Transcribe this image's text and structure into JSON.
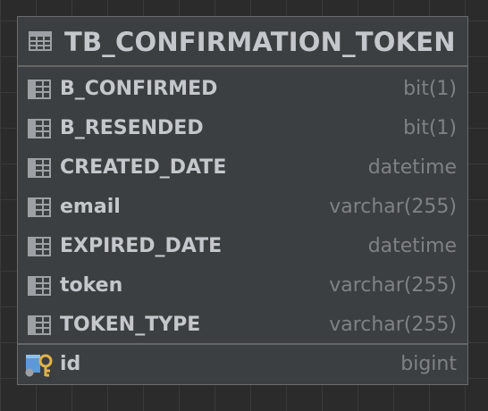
{
  "table": {
    "name": "TB_CONFIRMATION_TOKEN",
    "columns": [
      {
        "name": "B_CONFIRMED",
        "type": "bit(1)"
      },
      {
        "name": "B_RESENDED",
        "type": "bit(1)"
      },
      {
        "name": "CREATED_DATE",
        "type": "datetime"
      },
      {
        "name": "email",
        "type": "varchar(255)"
      },
      {
        "name": "EXPIRED_DATE",
        "type": "datetime"
      },
      {
        "name": "token",
        "type": "varchar(255)"
      },
      {
        "name": "TOKEN_TYPE",
        "type": "varchar(255)"
      }
    ],
    "primary_key": {
      "name": "id",
      "type": "bigint"
    }
  },
  "icons": {
    "table": "table-icon",
    "column": "column-icon",
    "primary_key": "primary-key-icon"
  },
  "colors": {
    "background": "#2b2b2b",
    "grid": "#3a3a3a",
    "entity_fill": "#3c3f41",
    "text": "#c4c7cc",
    "type_text": "#7f8285",
    "key": "#e0b34a",
    "column_icon_accent": "#5a9ad6"
  }
}
